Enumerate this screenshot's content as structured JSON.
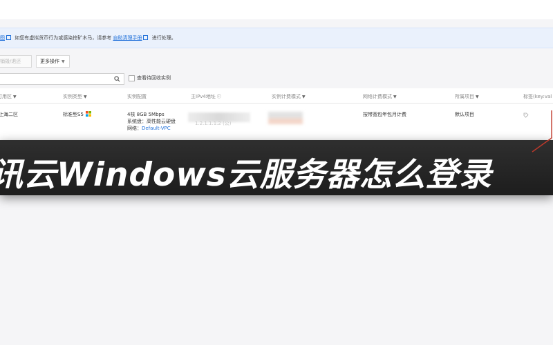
{
  "notice": {
    "prefix": "图",
    "text1": "如您有虚拟货币行为或感染挖矿木马，请参考",
    "link": "自助清理手册",
    "text2": "进行处理。"
  },
  "toolbar": {
    "destroy_label": "销毁/退还",
    "more_label": "更多操作"
  },
  "search": {
    "checkbox_label": "查看待回收实例"
  },
  "table": {
    "headers": {
      "zone": "可用区",
      "type": "实例类型",
      "config": "实例配置",
      "ipv4": "主IPv4地址",
      "billing": "实例计费模式",
      "net_billing": "网络计费模式",
      "project": "所属项目",
      "tags": "标签(key:val"
    },
    "row": {
      "zone": "上海二区",
      "type": "标准型S5",
      "config_line1": "4核 8GB 5Mbps",
      "config_line2": "系统盘：高性能云硬盘",
      "config_line3_label": "网络：",
      "config_line3_value": "Default-VPC",
      "ipv4": "1.2.1.1.1.2 (公)",
      "net_billing": "按带宽包年包月计费",
      "project": "默认项目"
    }
  },
  "banner": {
    "title": "讯云Windows云服务器怎么登录"
  },
  "colors": {
    "accent": "#1e6fd9",
    "banner_bg": "#222222",
    "notice_bg": "#eaf1fc"
  }
}
